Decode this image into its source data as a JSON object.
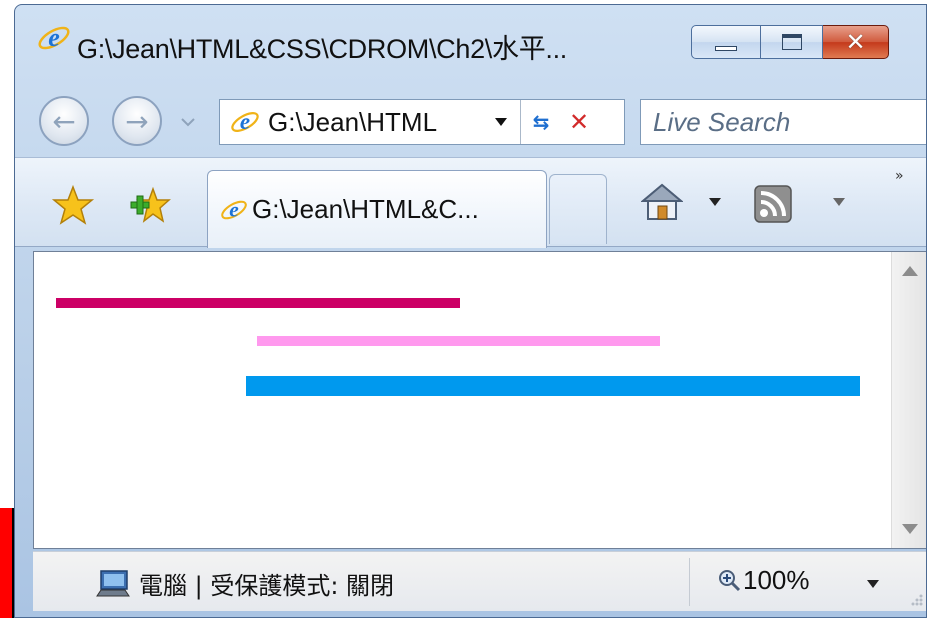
{
  "window": {
    "title": "G:\\Jean\\HTML&CSS\\CDROM\\Ch2\\水平...",
    "controls": {
      "minimize_icon": "minimize-icon",
      "maximize_icon": "maximize-icon",
      "close_label": "✕"
    }
  },
  "navigation": {
    "back_icon": "back-arrow-icon",
    "forward_icon": "forward-arrow-icon",
    "address_value": "G:\\Jean\\HTML",
    "search_placeholder": "Live Search"
  },
  "toolbar": {
    "favorites_icon": "favorites-star-icon",
    "add_favorite_icon": "add-favorite-icon",
    "active_tab_label": "G:\\Jean\\HTML&C...",
    "home_icon": "home-icon",
    "feeds_icon": "rss-feed-icon",
    "more_label": "»"
  },
  "content": {
    "lines": [
      {
        "color": "#cc0066"
      },
      {
        "color": "#ff99ee"
      },
      {
        "color": "#0099ee"
      }
    ]
  },
  "statusbar": {
    "zone_text": "電腦 | 受保護模式: 關閉",
    "zoom_text": "100%"
  },
  "colors": {
    "desktop": "#ff0000",
    "frame": "#b9cfe8"
  }
}
